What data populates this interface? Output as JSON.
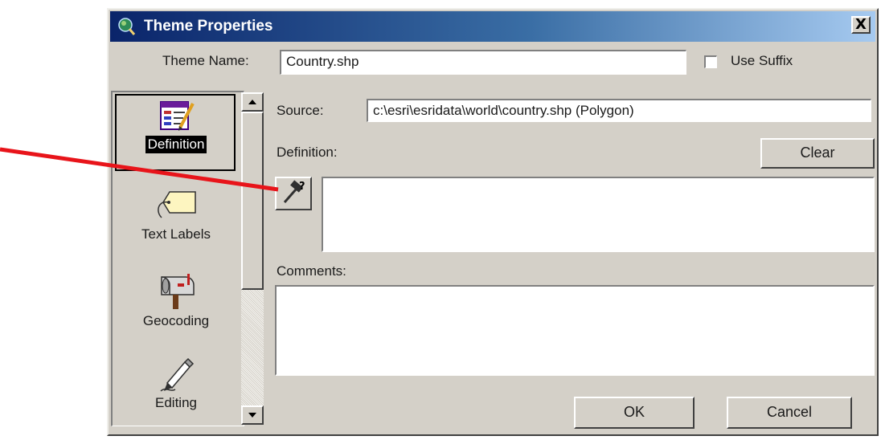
{
  "window": {
    "title": "Theme Properties",
    "close_glyph": "X"
  },
  "theme_name": {
    "label": "Theme Name:",
    "value": "Country.shp"
  },
  "use_suffix": {
    "label": "Use Suffix",
    "checked": false
  },
  "sidebar": {
    "items": [
      {
        "label": "Definition",
        "icon": "definition-icon",
        "selected": true
      },
      {
        "label": "Text Labels",
        "icon": "tag-icon",
        "selected": false
      },
      {
        "label": "Geocoding",
        "icon": "mailbox-icon",
        "selected": false
      },
      {
        "label": "Editing",
        "icon": "pencil-icon",
        "selected": false
      }
    ]
  },
  "source": {
    "label": "Source:",
    "value": "c:\\esri\\esridata\\world\\country.shp (Polygon)"
  },
  "definition": {
    "label": "Definition:",
    "clear_label": "Clear",
    "value": ""
  },
  "comments": {
    "label": "Comments:",
    "value": ""
  },
  "buttons": {
    "ok": "OK",
    "cancel": "Cancel"
  },
  "colors": {
    "title_bar_start": "#0a246a",
    "title_bar_end": "#a6caf0",
    "dialog_face": "#d4d0c8",
    "annotation_arrow": "#e8141a"
  }
}
